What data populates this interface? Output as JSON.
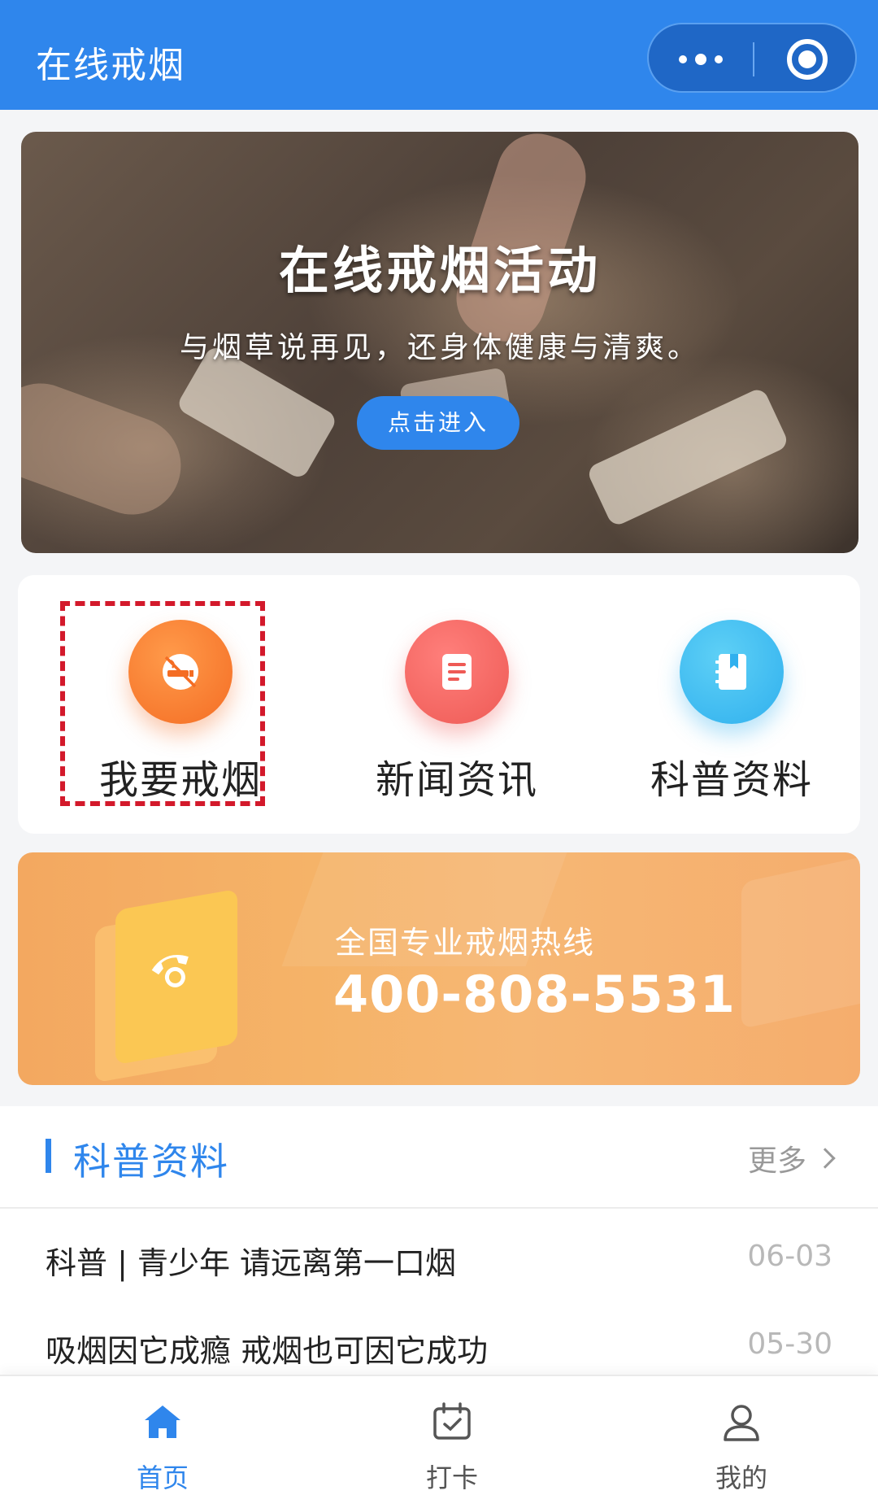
{
  "header": {
    "title": "在线戒烟",
    "more_icon": "more-dots-icon",
    "close_icon": "target-close-icon"
  },
  "banner": {
    "headline": "在线戒烟活动",
    "subtitle": "与烟草说再见，还身体健康与清爽。",
    "button_label": "点击进入"
  },
  "menu": {
    "items": [
      {
        "label": "我要戒烟",
        "icon": "no-smoking-icon",
        "color": "#f46d24"
      },
      {
        "label": "新闻资讯",
        "icon": "document-icon",
        "color": "#ee5a55"
      },
      {
        "label": "科普资料",
        "icon": "notebook-icon",
        "color": "#30b0ee"
      }
    ],
    "highlight_color": "#d3192b"
  },
  "hotline": {
    "caption": "全国专业戒烟热线",
    "number": "400-808-5531",
    "icon": "phone-icon"
  },
  "section": {
    "title": "科普资料",
    "more_label": "更多"
  },
  "articles": [
    {
      "title": "科普 | 青少年 请远离第一口烟",
      "date": "06-03"
    },
    {
      "title": "吸烟因它成瘾 戒烟也可因它成功",
      "date": "05-30"
    }
  ],
  "tabbar": {
    "items": [
      {
        "label": "首页",
        "icon": "home-icon",
        "active": true
      },
      {
        "label": "打卡",
        "icon": "calendar-check-icon",
        "active": false
      },
      {
        "label": "我的",
        "icon": "user-icon",
        "active": false
      }
    ],
    "active_color": "#2f86ec"
  },
  "colors": {
    "brand": "#2f86ec",
    "hotline_bg": "#f5b368"
  }
}
